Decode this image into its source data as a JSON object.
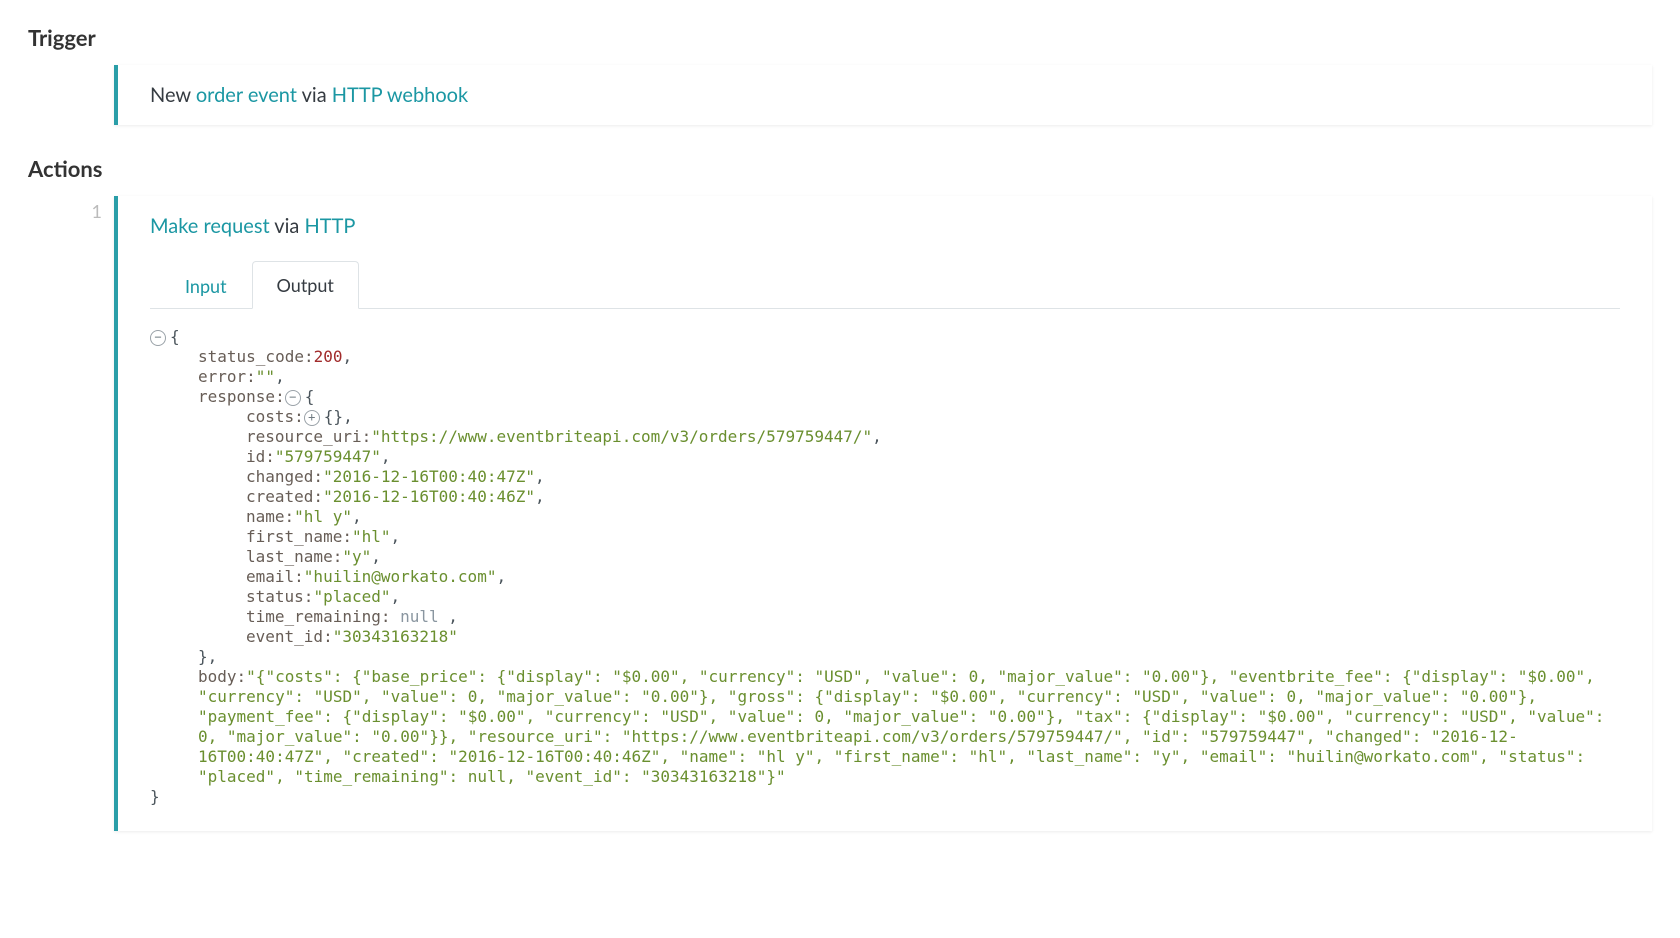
{
  "sections": {
    "trigger_title": "Trigger",
    "actions_title": "Actions"
  },
  "trigger": {
    "prefix": "New ",
    "link1": "order event",
    "mid": " via ",
    "link2": "HTTP webhook"
  },
  "action": {
    "number": "1",
    "link1": "Make request",
    "mid": " via ",
    "link2": "HTTP"
  },
  "tabs": {
    "input": "Input",
    "output": "Output"
  },
  "output": {
    "status_code_key": "status_code:",
    "status_code_val": "200",
    "error_key": "error:",
    "error_val": "\"\"",
    "response_key": "response:",
    "costs_key": "costs:",
    "resource_uri_key": "resource_uri:",
    "resource_uri_val": "\"https://www.eventbriteapi.com/v3/orders/579759447/\"",
    "id_key": "id:",
    "id_val": "\"579759447\"",
    "changed_key": "changed:",
    "changed_val": "\"2016-12-16T00:40:47Z\"",
    "created_key": "created:",
    "created_val": "\"2016-12-16T00:40:46Z\"",
    "name_key": "name:",
    "name_val": "\"hl y\"",
    "first_name_key": "first_name:",
    "first_name_val": "\"hl\"",
    "last_name_key": "last_name:",
    "last_name_val": "\"y\"",
    "email_key": "email:",
    "email_val": "\"huilin@workato.com\"",
    "status_key": "status:",
    "status_val": "\"placed\"",
    "time_remaining_key": "time_remaining:",
    "time_remaining_val": " null ",
    "event_id_key": "event_id:",
    "event_id_val": "\"30343163218\"",
    "body_key": "body:",
    "body_val": "\"{\"costs\": {\"base_price\": {\"display\": \"$0.00\", \"currency\": \"USD\", \"value\": 0, \"major_value\": \"0.00\"}, \"eventbrite_fee\": {\"display\": \"$0.00\", \"currency\": \"USD\", \"value\": 0, \"major_value\": \"0.00\"}, \"gross\": {\"display\": \"$0.00\", \"currency\": \"USD\", \"value\": 0, \"major_value\": \"0.00\"}, \"payment_fee\": {\"display\": \"$0.00\", \"currency\": \"USD\", \"value\": 0, \"major_value\": \"0.00\"}, \"tax\": {\"display\": \"$0.00\", \"currency\": \"USD\", \"value\": 0, \"major_value\": \"0.00\"}}, \"resource_uri\": \"https://www.eventbriteapi.com/v3/orders/579759447/\", \"id\": \"579759447\", \"changed\": \"2016-12-16T00:40:47Z\", \"created\": \"2016-12-16T00:40:46Z\", \"name\": \"hl y\", \"first_name\": \"hl\", \"last_name\": \"y\", \"email\": \"huilin@workato.com\", \"status\": \"placed\", \"time_remaining\": null, \"event_id\": \"30343163218\"}\""
  }
}
